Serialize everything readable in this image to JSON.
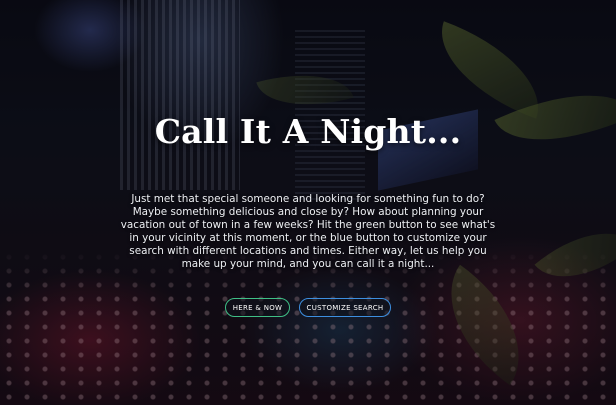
{
  "hero": {
    "title": "Call It A Night...",
    "description": "Just met that special someone and looking for something fun to do? Maybe something delicious and close by? How about planning your vacation out of town in a few weeks? Hit the green button to see what's in your vicinity at this moment, or the blue button to customize your search with different locations and times. Either way, let us help you make up your mind, and you can call it a night...",
    "buttons": {
      "here_now_label": "HERE & NOW",
      "customize_label": "CUSTOMIZE SEARCH"
    }
  },
  "colors": {
    "here_now_border": "#3fbf86",
    "customize_border": "#3d8fe0",
    "title_text": "#ffffff"
  }
}
